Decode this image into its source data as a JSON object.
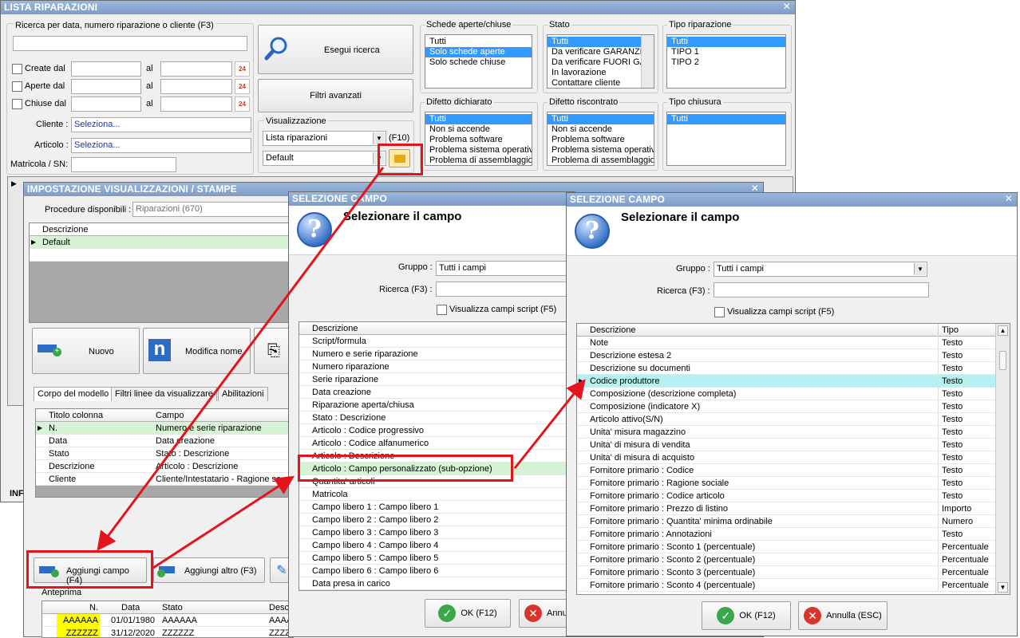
{
  "main": {
    "title": "LISTA RIPARAZIONI",
    "search_label": "Ricerca per data, numero riparazione o cliente (F3)",
    "create_label": "Create dal",
    "open_label": "Aperte dal",
    "closed_label": "Chiuse dal",
    "al": "al",
    "cal_num": "24",
    "cliente_label": "Cliente :",
    "cliente_value": "Seleziona...",
    "articolo_label": "Articolo :",
    "articolo_value": "Seleziona...",
    "matricola_label": "Matricola / SN:",
    "esegui": "Esegui ricerca",
    "filtri": "Filtri avanzati",
    "visual_label": "Visualizzazione",
    "visual_value": "Lista riparazioni",
    "visual_key": "(F10)",
    "default_value": "Default",
    "schede_label": "Schede aperte/chiuse",
    "schede": [
      "Tutti",
      "Solo schede aperte",
      "Solo schede chiuse"
    ],
    "stato_label": "Stato",
    "stato": [
      "Tutti",
      "Da verificare GARANZIA",
      "Da verificare FUORI GA",
      "In lavorazione",
      "Contattare cliente"
    ],
    "tipo_rip_label": "Tipo riparazione",
    "tipo_rip": [
      "Tutti",
      "TIPO 1",
      "TIPO 2"
    ],
    "difetto_dich_label": "Difetto dichiarato",
    "difetto_dich": [
      "Tutti",
      "Non si accende",
      "Problema software",
      "Problema sistema operativo",
      "Problema di assemblaggio"
    ],
    "difetto_risc_label": "Difetto riscontrato",
    "difetto_risc": [
      "Tutti",
      "Non si accende",
      "Problema software",
      "Problema sistema operativo",
      "Problema di assemblaggio"
    ],
    "tipo_chiusura_label": "Tipo chiusura",
    "tipo_chiusura": [
      "Tutti"
    ],
    "inf_label": "INF"
  },
  "impost": {
    "title": "IMPOSTAZIONE VISUALIZZAZIONI / STAMPE",
    "procedure_label": "Procedure disponibili :",
    "procedure_value": "Riparazioni (670)",
    "desc_header": "Descrizione",
    "default_row": "Default",
    "nuovo": "Nuovo",
    "modifica": "Modifica nome",
    "tabs": [
      "Corpo del modello",
      "Filtri linee da visualizzare",
      "Abilitazioni"
    ],
    "col_titolo": "Titolo colonna",
    "col_campo": "Campo",
    "rows": [
      {
        "t": "N.",
        "c": "Numero e serie riparazione"
      },
      {
        "t": "Data",
        "c": "Data creazione"
      },
      {
        "t": "Stato",
        "c": "Stato : Descrizione"
      },
      {
        "t": "Descrizione",
        "c": "Articolo : Descrizione"
      },
      {
        "t": "Cliente",
        "c": "Cliente/Intestatario - Ragione so"
      }
    ],
    "aggiungi_campo": "Aggiungi campo (F4)",
    "aggiungi_altro": "Aggiungi altro (F3)",
    "anteprima": "Anteprima",
    "prev_headers": [
      "N.",
      "Data",
      "Stato",
      "Descri"
    ],
    "prev_rows": [
      {
        "n": "AAAAAA",
        "d": "01/01/1980",
        "s": "AAAAAA",
        "x": "AAAA"
      },
      {
        "n": "ZZZZZZ",
        "d": "31/12/2020",
        "s": "ZZZZZZ",
        "x": "ZZZZ"
      }
    ]
  },
  "sel1": {
    "title": "SELEZIONE CAMPO",
    "heading": "Selezionare il campo",
    "gruppo_label": "Gruppo :",
    "gruppo_value": "Tutti i campi",
    "ricerca_label": "Ricerca (F3) :",
    "script_label": "Visualizza campi script (F5)",
    "desc_header": "Descrizione",
    "rows": [
      "Script/formula",
      "Numero e serie riparazione",
      "Numero riparazione",
      "Serie riparazione",
      "Data creazione",
      "Riparazione aperta/chiusa",
      "Stato : Descrizione",
      "Articolo : Codice progressivo",
      "Articolo : Codice alfanumerico",
      "Articolo : Descrizione",
      "Articolo : Campo personalizzato (sub-opzione)",
      "Quantita' articoli",
      "Matricola",
      "Campo libero 1 : Campo libero 1",
      "Campo libero 2 : Campo libero 2",
      "Campo libero 3 : Campo libero 3",
      "Campo libero 4 : Campo libero 4",
      "Campo libero 5 : Campo libero 5",
      "Campo libero 6 : Campo libero 6",
      "Data presa in carico"
    ],
    "ok": "OK (F12)",
    "annulla": "Annu"
  },
  "sel2": {
    "title": "SELEZIONE CAMPO",
    "heading": "Selezionare il campo",
    "gruppo_label": "Gruppo :",
    "gruppo_value": "Tutti i campi",
    "ricerca_label": "Ricerca (F3) :",
    "script_label": "Visualizza campi script (F5)",
    "desc_header": "Descrizione",
    "tipo_header": "Tipo",
    "rows": [
      {
        "d": "Note",
        "t": "Testo"
      },
      {
        "d": "Descrizione estesa 2",
        "t": "Testo"
      },
      {
        "d": "Descrizione su documenti",
        "t": "Testo"
      },
      {
        "d": "Codice produttore",
        "t": "Testo"
      },
      {
        "d": "Composizione (descrizione completa)",
        "t": "Testo"
      },
      {
        "d": "Composizione (indicatore X)",
        "t": "Testo"
      },
      {
        "d": "Articolo attivo(S/N)",
        "t": "Testo"
      },
      {
        "d": "Unita' misura magazzino",
        "t": "Testo"
      },
      {
        "d": "Unita' di misura di vendita",
        "t": "Testo"
      },
      {
        "d": "Unita' di misura di acquisto",
        "t": "Testo"
      },
      {
        "d": "Fornitore primario : Codice",
        "t": "Testo"
      },
      {
        "d": "Fornitore primario : Ragione sociale",
        "t": "Testo"
      },
      {
        "d": "Fornitore primario : Codice articolo",
        "t": "Testo"
      },
      {
        "d": "Fornitore primario : Prezzo di listino",
        "t": "Importo"
      },
      {
        "d": "Fornitore primario : Quantita' minima ordinabile",
        "t": "Numero"
      },
      {
        "d": "Fornitore primario : Annotazioni",
        "t": "Testo"
      },
      {
        "d": "Fornitore primario : Sconto 1 (percentuale)",
        "t": "Percentuale"
      },
      {
        "d": "Fornitore primario : Sconto 2 (percentuale)",
        "t": "Percentuale"
      },
      {
        "d": "Fornitore primario : Sconto 3 (percentuale)",
        "t": "Percentuale"
      },
      {
        "d": "Fornitore primario : Sconto 4 (percentuale)",
        "t": "Percentuale"
      }
    ],
    "ok": "OK (F12)",
    "annulla": "Annulla (ESC)"
  },
  "colors": {
    "accent": "#3399ff",
    "highlight_green": "#d6f3d6",
    "highlight_cyan": "#b7f0f0",
    "annot_red": "#e3141b",
    "preview_yellow": "#ffff00"
  }
}
